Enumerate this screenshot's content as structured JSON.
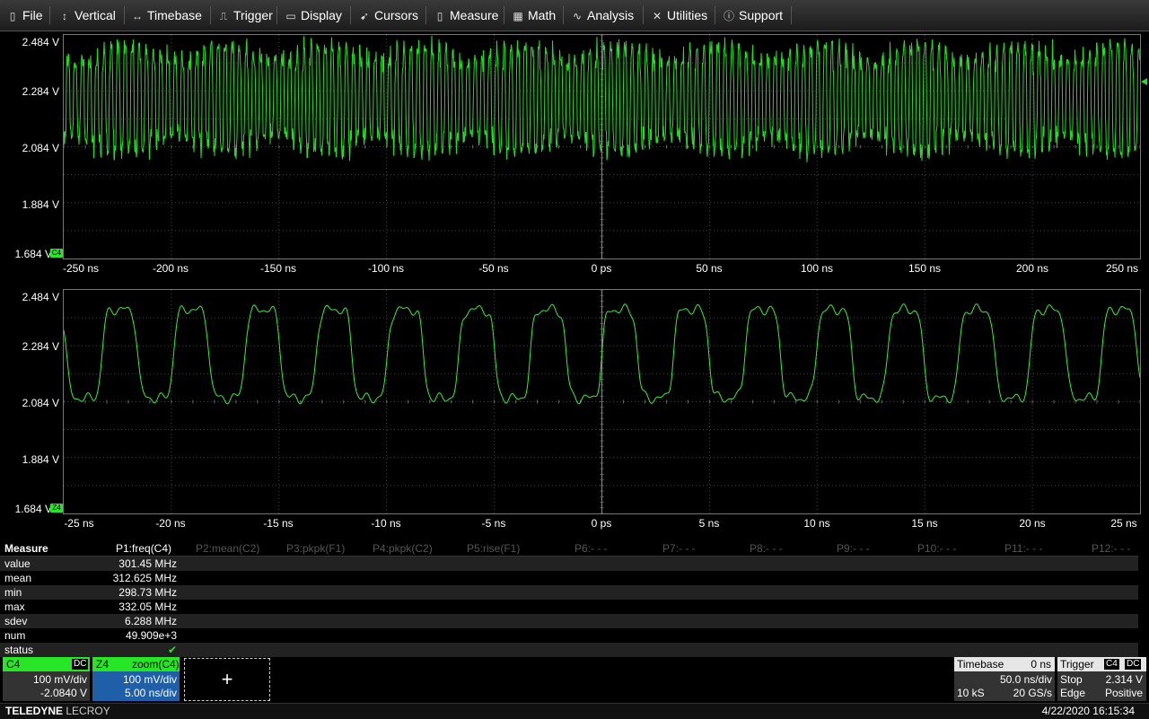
{
  "menu": {
    "items": [
      {
        "label": "File",
        "icon": "clipboard-icon",
        "glyph": "▯"
      },
      {
        "label": "Vertical",
        "icon": "vertical-arrows-icon",
        "glyph": "↕"
      },
      {
        "label": "Timebase",
        "icon": "horizontal-arrows-icon",
        "glyph": "↔"
      },
      {
        "label": "Trigger",
        "icon": "trigger-edge-icon",
        "glyph": "⎍"
      },
      {
        "label": "Display",
        "icon": "display-icon",
        "glyph": "▭"
      },
      {
        "label": "Cursors",
        "icon": "cursor-icon",
        "glyph": "➹"
      },
      {
        "label": "Measure",
        "icon": "measure-icon",
        "glyph": "▯"
      },
      {
        "label": "Math",
        "icon": "calculator-icon",
        "glyph": "▦"
      },
      {
        "label": "Analysis",
        "icon": "analysis-icon",
        "glyph": "∿"
      },
      {
        "label": "Utilities",
        "icon": "tools-icon",
        "glyph": "✕"
      },
      {
        "label": "Support",
        "icon": "info-icon",
        "glyph": "ⓘ"
      }
    ]
  },
  "upper_grid": {
    "y_labels": [
      "2.484 V",
      "2.284 V",
      "2.084 V",
      "1.884 V",
      "1.684 V"
    ],
    "x_labels": [
      "-250 ns",
      "-200 ns",
      "-150 ns",
      "-100 ns",
      "-50 ns",
      "0 ps",
      "50 ns",
      "100 ns",
      "150 ns",
      "200 ns",
      "250 ns"
    ],
    "badge": "C4",
    "x_range_ns": [
      -250,
      250
    ],
    "y_range_v": [
      1.684,
      2.484
    ],
    "trace_color": "#22dd22"
  },
  "lower_grid": {
    "y_labels": [
      "2.484 V",
      "2.284 V",
      "2.084 V",
      "1.884 V",
      "1.684 V"
    ],
    "x_labels": [
      "-25 ns",
      "-20 ns",
      "-15 ns",
      "-10 ns",
      "-5 ns",
      "0 ps",
      "5 ns",
      "10 ns",
      "15 ns",
      "20 ns",
      "25 ns"
    ],
    "badge": "Z4",
    "x_range_ns": [
      -25,
      25
    ],
    "y_range_v": [
      1.684,
      2.484
    ],
    "trace_color": "#33ee33",
    "signal_frequency_mhz": 301.45
  },
  "measure": {
    "title": "Measure",
    "headers": [
      "P1:freq(C4)",
      "P2:mean(C2)",
      "P3:pkpk(F1)",
      "P4:pkpk(C2)",
      "P5:rise(F1)",
      "P6:- - -",
      "P7:- - -",
      "P8:- - -",
      "P9:- - -",
      "P10:- - -",
      "P11:- - -",
      "P12:- - -"
    ],
    "rows": [
      {
        "label": "value",
        "v": "301.45 MHz"
      },
      {
        "label": "mean",
        "v": "312.625 MHz"
      },
      {
        "label": "min",
        "v": "298.73 MHz"
      },
      {
        "label": "max",
        "v": "332.05 MHz"
      },
      {
        "label": "sdev",
        "v": "6.288 MHz"
      },
      {
        "label": "num",
        "v": "49.909e+3"
      },
      {
        "label": "status",
        "v": "✔"
      }
    ]
  },
  "c4_dialog": {
    "name": "C4",
    "coupling": "DC",
    "vdiv": "100 mV/div",
    "offset": "-2.0840 V"
  },
  "z4_dialog": {
    "name": "Z4",
    "source": "zoom(C4)",
    "vdiv": "100 mV/div",
    "tdiv": "5.00 ns/div"
  },
  "add_box": {
    "glyph": "+"
  },
  "timebase": {
    "title": "Timebase",
    "delay": "0 ns",
    "tdiv": "50.0 ns/div",
    "samples": "10 kS",
    "rate": "20 GS/s"
  },
  "trigger": {
    "title": "Trigger",
    "source": "C4",
    "coupling": "DC",
    "mode": "Stop",
    "level": "2.314 V",
    "type": "Edge",
    "slope": "Positive"
  },
  "footer": {
    "brand_bold": "TELEDYNE",
    "brand_light": "LECROY",
    "datetime": "4/22/2020 16:15:34"
  },
  "colors": {
    "trace": "#22dd22",
    "badge_green": "#26e626",
    "zoom_blue": "#1e5fa8"
  }
}
